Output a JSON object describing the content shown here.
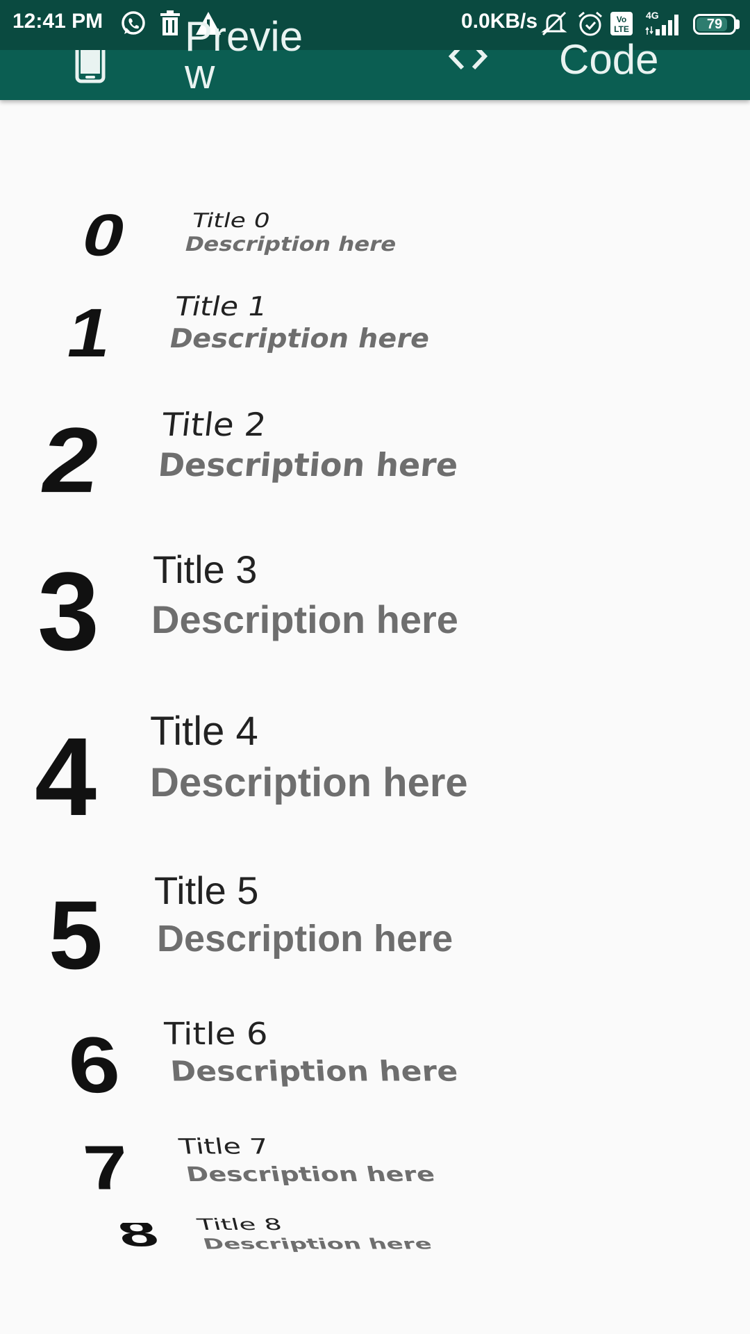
{
  "status_bar": {
    "time": "12:41 PM",
    "network_speed": "0.0KB/s",
    "network_type": "4G",
    "volte": "Vo LTE",
    "battery": "79",
    "icons": [
      "whatsapp-icon",
      "trash-icon",
      "warning-icon",
      "mute-icon",
      "alarm-icon",
      "volte-icon",
      "signal-icon",
      "battery-icon"
    ]
  },
  "toolbar": {
    "preview_tab_label": "Previe\nw",
    "code_tab_label": "Code",
    "preview_icon": "phone-icon",
    "code_icon": "code-brackets-icon",
    "background": "#0b5e52"
  },
  "list": {
    "items": [
      {
        "number": "0",
        "title": "Title 0",
        "description": "Description here"
      },
      {
        "number": "1",
        "title": "Title 1",
        "description": "Description here"
      },
      {
        "number": "2",
        "title": "Title 2",
        "description": "Description here"
      },
      {
        "number": "3",
        "title": "Title 3",
        "description": "Description here"
      },
      {
        "number": "4",
        "title": "Title 4",
        "description": "Description here"
      },
      {
        "number": "5",
        "title": "Title 5",
        "description": "Description here"
      },
      {
        "number": "6",
        "title": "Title 6",
        "description": "Description here"
      },
      {
        "number": "7",
        "title": "Title 7",
        "description": "Description here"
      },
      {
        "number": "8",
        "title": "Title 8",
        "description": "Description here"
      }
    ]
  }
}
